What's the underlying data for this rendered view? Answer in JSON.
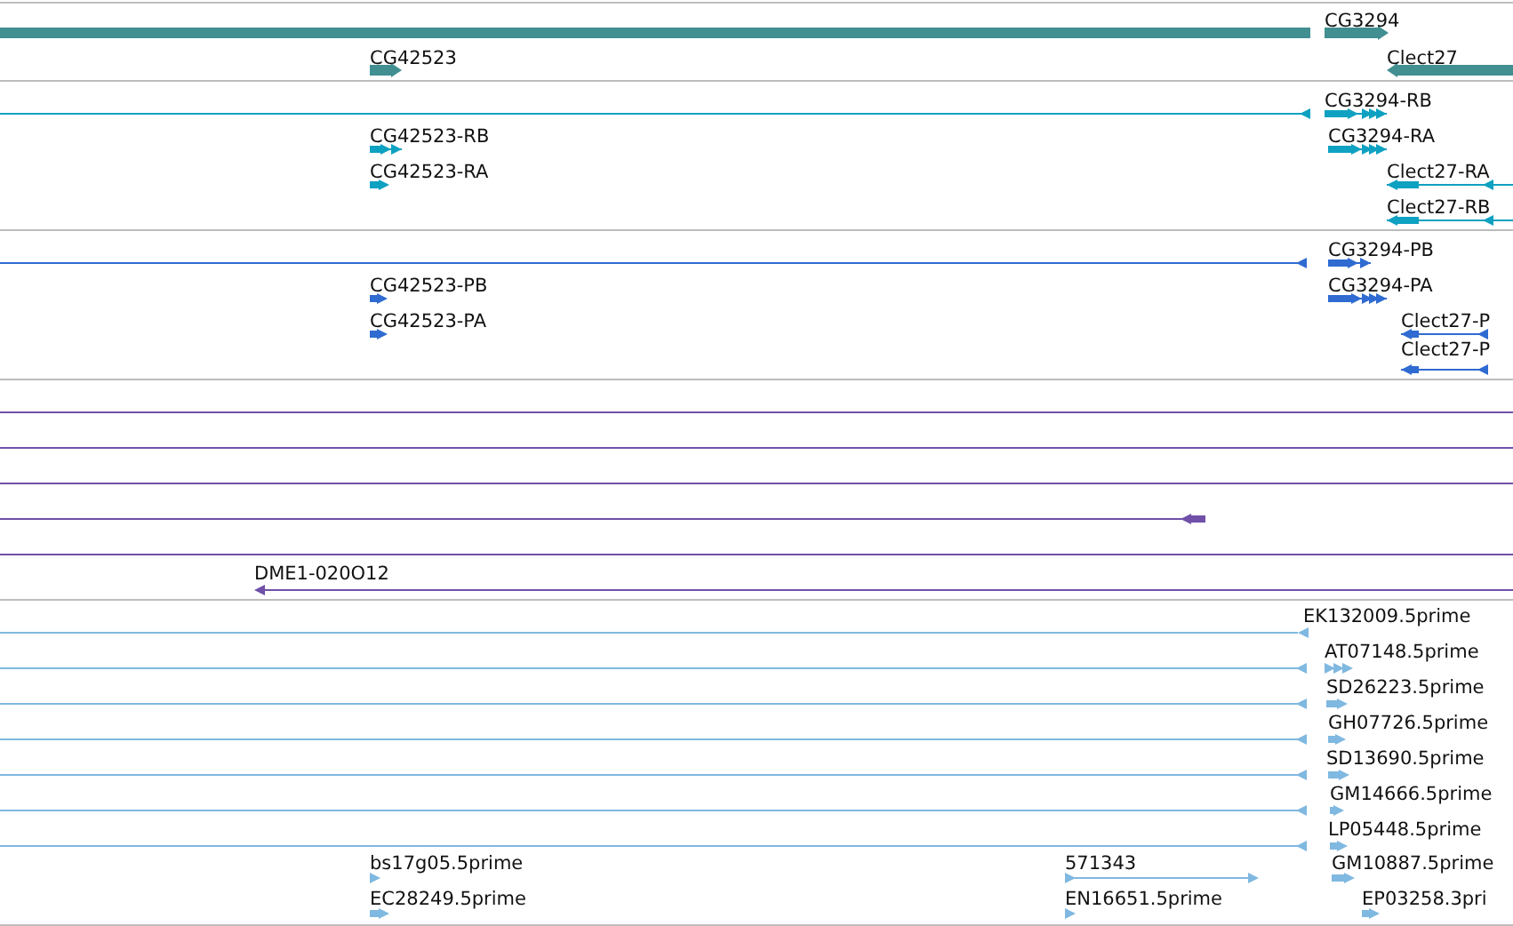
{
  "tracks": [
    {
      "kind": "gene",
      "color": "#418f91",
      "features": [
        {
          "kind": "bar"
        },
        {
          "kind": "arrow",
          "label": "CG3294",
          "reverse": false
        },
        {
          "kind": "arrow",
          "label": "CG42523",
          "reverse": false
        },
        {
          "kind": "arrow",
          "label": "Clect27",
          "reverse": true
        }
      ]
    },
    {
      "kind": "transcript",
      "color": "#0ea1c1",
      "features": [
        {
          "kind": "arrow",
          "reverse": true
        },
        {
          "kind": "arrow",
          "label": "CG3294-RB",
          "reverse": false
        },
        {
          "kind": "arrow",
          "label": "CG42523-RB",
          "reverse": false
        },
        {
          "kind": "arrow",
          "label": "CG3294-RA",
          "reverse": false
        },
        {
          "kind": "arrow",
          "label": "CG42523-RA",
          "reverse": false
        },
        {
          "kind": "arrow",
          "label": "Clect27-RA",
          "reverse": true
        },
        {
          "kind": "arrow",
          "label": "Clect27-RB",
          "reverse": true
        }
      ]
    },
    {
      "kind": "protein",
      "color": "#2f6bd1",
      "features": [
        {
          "kind": "arrow",
          "reverse": true
        },
        {
          "kind": "arrow",
          "label": "CG3294-PB",
          "reverse": false
        },
        {
          "kind": "arrow",
          "label": "CG42523-PB",
          "reverse": false
        },
        {
          "kind": "arrow",
          "label": "CG3294-PA",
          "reverse": false
        },
        {
          "kind": "arrow",
          "label": "CG42523-PA",
          "reverse": false
        },
        {
          "kind": "arrow",
          "label": "Clect27-P",
          "reverse": true
        },
        {
          "kind": "arrow",
          "label": "Clect27-P",
          "reverse": true
        }
      ]
    },
    {
      "kind": "clone",
      "color": "#7050a8",
      "features": [
        {
          "kind": "line"
        },
        {
          "kind": "line"
        },
        {
          "kind": "line"
        },
        {
          "kind": "arrow",
          "reverse": true
        },
        {
          "kind": "line"
        },
        {
          "kind": "arrow",
          "label": "DME1-020O12",
          "reverse": true
        }
      ]
    },
    {
      "kind": "est",
      "color": "#7fb8e0",
      "features": [
        {
          "kind": "arrow",
          "label": "EK132009.5prime",
          "reverse": true
        },
        {
          "kind": "arrow",
          "reverse": true
        },
        {
          "kind": "arrow",
          "label": "AT07148.5prime",
          "reverse": false
        },
        {
          "kind": "arrow",
          "reverse": true
        },
        {
          "kind": "arrow",
          "label": "SD26223.5prime",
          "reverse": false
        },
        {
          "kind": "arrow",
          "reverse": true
        },
        {
          "kind": "arrow",
          "label": "GH07726.5prime",
          "reverse": false
        },
        {
          "kind": "arrow",
          "reverse": true
        },
        {
          "kind": "arrow",
          "label": "SD13690.5prime",
          "reverse": false
        },
        {
          "kind": "arrow",
          "reverse": true
        },
        {
          "kind": "arrow",
          "label": "GM14666.5prime",
          "reverse": false
        },
        {
          "kind": "arrow",
          "reverse": true
        },
        {
          "kind": "arrow",
          "label": "LP05448.5prime",
          "reverse": false
        },
        {
          "kind": "arrow",
          "label": "bs17g05.5prime",
          "reverse": false
        },
        {
          "kind": "arrow",
          "label": "571343",
          "reverse": false
        },
        {
          "kind": "arrow",
          "label": "GM10887.5prime",
          "reverse": false
        },
        {
          "kind": "arrow",
          "label": "EC28249.5prime",
          "reverse": false
        },
        {
          "kind": "arrow",
          "label": "EN16651.5prime",
          "reverse": false
        },
        {
          "kind": "arrow",
          "label": "EP03258.3pri",
          "reverse": false
        }
      ]
    }
  ]
}
